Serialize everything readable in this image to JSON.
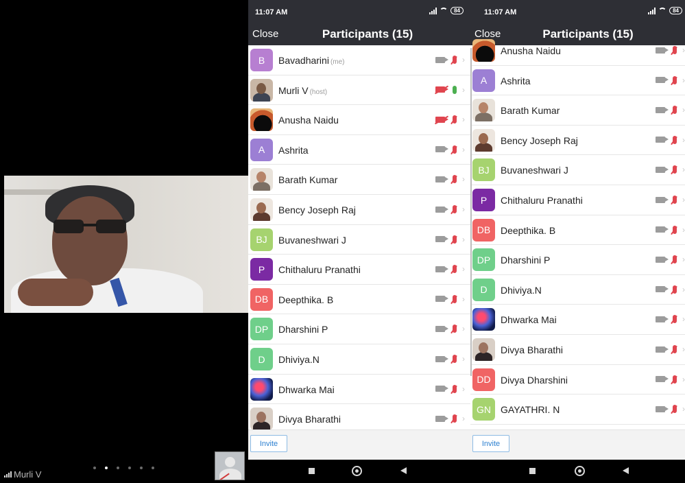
{
  "video_panel": {
    "speaker_name": "Murli V",
    "page_dots": 6,
    "active_dot": 1
  },
  "screens": [
    {
      "status": {
        "time": "11:07 AM",
        "battery": "84"
      },
      "nav": {
        "close_label": "Close",
        "title": "Participants (15)"
      },
      "invite_label": "Invite",
      "participants": [
        {
          "initials": "B",
          "name": "Bavadharini",
          "tag": "(me)",
          "avatar_color": "#b77fd1",
          "cam_off": false,
          "mic_on": false
        },
        {
          "initials": "",
          "name": "Murli V",
          "tag": "(host)",
          "avatar_style": "photo",
          "cam_off": true,
          "mic_on": true
        },
        {
          "initials": "",
          "name": "Anusha Naidu",
          "tag": "",
          "avatar_style": "dark",
          "cam_off": true,
          "mic_on": false
        },
        {
          "initials": "A",
          "name": "Ashrita",
          "tag": "",
          "avatar_color": "#9c7fd4",
          "cam_off": false,
          "mic_on": false
        },
        {
          "initials": "",
          "name": "Barath Kumar",
          "tag": "",
          "avatar_style": "child",
          "cam_off": false,
          "mic_on": false
        },
        {
          "initials": "",
          "name": "Bency Joseph Raj",
          "tag": "",
          "avatar_style": "woman",
          "cam_off": false,
          "mic_on": false
        },
        {
          "initials": "BJ",
          "name": "Buvaneshwari J",
          "tag": "",
          "avatar_color": "#a6d36f",
          "cam_off": false,
          "mic_on": false
        },
        {
          "initials": "P",
          "name": "Chithaluru Pranathi",
          "tag": "",
          "avatar_color": "#7b2aa3",
          "cam_off": false,
          "mic_on": false
        },
        {
          "initials": "DB",
          "name": "Deepthika. B",
          "tag": "",
          "avatar_color": "#f06464",
          "cam_off": false,
          "mic_on": false
        },
        {
          "initials": "DP",
          "name": "Dharshini P",
          "tag": "",
          "avatar_color": "#6fcf8a",
          "cam_off": false,
          "mic_on": false
        },
        {
          "initials": "D",
          "name": "Dhiviya.N",
          "tag": "",
          "avatar_color": "#6fcf8a",
          "cam_off": false,
          "mic_on": false
        },
        {
          "initials": "",
          "name": "Dhwarka Mai",
          "tag": "",
          "avatar_style": "planet",
          "cam_off": false,
          "mic_on": false
        },
        {
          "initials": "",
          "name": "Divya Bharathi",
          "tag": "",
          "avatar_style": "darkhair",
          "cam_off": false,
          "mic_on": false
        }
      ]
    },
    {
      "status": {
        "time": "11:07 AM",
        "battery": "84"
      },
      "nav": {
        "close_label": "Close",
        "title": "Participants (15)"
      },
      "invite_label": "Invite",
      "participants": [
        {
          "initials": "",
          "name": "Anusha Naidu",
          "tag": "",
          "avatar_style": "dark",
          "cam_off": false,
          "mic_on": false
        },
        {
          "initials": "A",
          "name": "Ashrita",
          "tag": "",
          "avatar_color": "#9c7fd4",
          "cam_off": false,
          "mic_on": false
        },
        {
          "initials": "",
          "name": "Barath Kumar",
          "tag": "",
          "avatar_style": "child",
          "cam_off": false,
          "mic_on": false
        },
        {
          "initials": "",
          "name": "Bency Joseph Raj",
          "tag": "",
          "avatar_style": "woman",
          "cam_off": false,
          "mic_on": false
        },
        {
          "initials": "BJ",
          "name": "Buvaneshwari J",
          "tag": "",
          "avatar_color": "#a6d36f",
          "cam_off": false,
          "mic_on": false
        },
        {
          "initials": "P",
          "name": "Chithaluru Pranathi",
          "tag": "",
          "avatar_color": "#7b2aa3",
          "cam_off": false,
          "mic_on": false
        },
        {
          "initials": "DB",
          "name": "Deepthika. B",
          "tag": "",
          "avatar_color": "#f06464",
          "cam_off": false,
          "mic_on": false
        },
        {
          "initials": "DP",
          "name": "Dharshini P",
          "tag": "",
          "avatar_color": "#6fcf8a",
          "cam_off": false,
          "mic_on": false
        },
        {
          "initials": "D",
          "name": "Dhiviya.N",
          "tag": "",
          "avatar_color": "#6fcf8a",
          "cam_off": false,
          "mic_on": false
        },
        {
          "initials": "",
          "name": "Dhwarka Mai",
          "tag": "",
          "avatar_style": "planet",
          "cam_off": false,
          "mic_on": false
        },
        {
          "initials": "",
          "name": "Divya Bharathi",
          "tag": "",
          "avatar_style": "darkhair",
          "cam_off": false,
          "mic_on": false
        },
        {
          "initials": "DD",
          "name": "Divya Dharshini",
          "tag": "",
          "avatar_color": "#f06464",
          "cam_off": false,
          "mic_on": false
        },
        {
          "initials": "GN",
          "name": "GAYATHRI. N",
          "tag": "",
          "avatar_color": "#a6d36f",
          "cam_off": false,
          "mic_on": false
        }
      ]
    }
  ]
}
